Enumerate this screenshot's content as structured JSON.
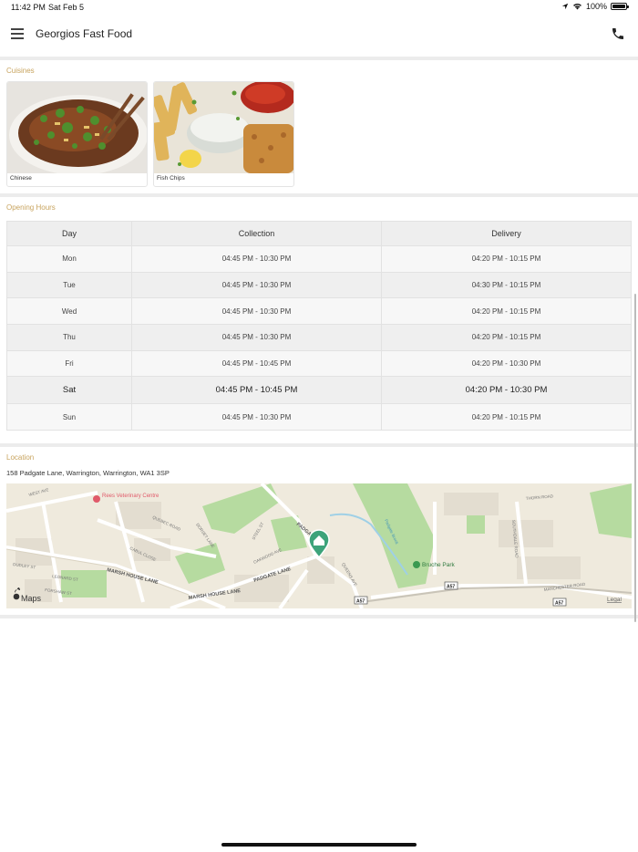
{
  "status_bar": {
    "time": "11:42 PM",
    "date": "Sat Feb 5",
    "battery": "100%"
  },
  "header": {
    "title": "Georgios Fast Food"
  },
  "cuisines": {
    "label": "Cuisines",
    "items": [
      {
        "name": "Chinese"
      },
      {
        "name": "Fish  Chips"
      }
    ]
  },
  "opening_hours": {
    "label": "Opening Hours",
    "columns": [
      "Day",
      "Collection",
      "Delivery"
    ],
    "rows": [
      {
        "day": "Mon",
        "collection": "04:45 PM - 10:30 PM",
        "delivery": "04:20 PM - 10:15 PM"
      },
      {
        "day": "Tue",
        "collection": "04:45 PM - 10:30 PM",
        "delivery": "04:30 PM - 10:15 PM"
      },
      {
        "day": "Wed",
        "collection": "04:45 PM - 10:30 PM",
        "delivery": "04:20 PM - 10:15 PM"
      },
      {
        "day": "Thu",
        "collection": "04:45 PM - 10:30 PM",
        "delivery": "04:20 PM - 10:15 PM"
      },
      {
        "day": "Fri",
        "collection": "04:45 PM - 10:45 PM",
        "delivery": "04:20 PM - 10:30 PM"
      },
      {
        "day": "Sat",
        "collection": "04:45 PM - 10:45 PM",
        "delivery": "04:20 PM - 10:30 PM"
      },
      {
        "day": "Sun",
        "collection": "04:45 PM - 10:30 PM",
        "delivery": "04:20 PM - 10:15 PM"
      }
    ]
  },
  "location": {
    "label": "Location",
    "address": "158 Padgate Lane, Warrington, Warrington, WA1 3SP",
    "map": {
      "attribution": "Maps",
      "legal": "Legal",
      "labels": {
        "vet": "Rees Veterinary Centre",
        "park": "Bruche Park",
        "marsh_house_lane": "MARSH HOUSE LANE",
        "marsh_house_lane_2": "MARSH HOUSE LANE",
        "padgate_lane": "PADGATE LANE",
        "padgate": "PADGATE",
        "quebec_road": "QUEBEC ROAD",
        "dorset_lane": "DORSET LANE",
        "cabul_close": "CABUL CLOSE",
        "oakwood_ave": "OAKWOOD AVE",
        "steel_st": "STEEL ST",
        "queens_ave": "QUEENS AVE",
        "west_ave": "WEST AVE",
        "thorn_road": "THORN ROAD",
        "manchester_road": "MANCHESTER ROAD",
        "southdale_road": "SOUTHDALE ROAD",
        "dudley_st": "DUDLEY ST",
        "leonard_st": "LEONARD ST",
        "forshaw_st": "FORSHAW ST",
        "padgate_brook": "Padgate Brook",
        "a57": "A57",
        "a57_2": "A57"
      }
    }
  },
  "colors": {
    "section_label": "#c8a45f",
    "map_pin": "#3da37a",
    "park_green": "#b6dba0"
  }
}
